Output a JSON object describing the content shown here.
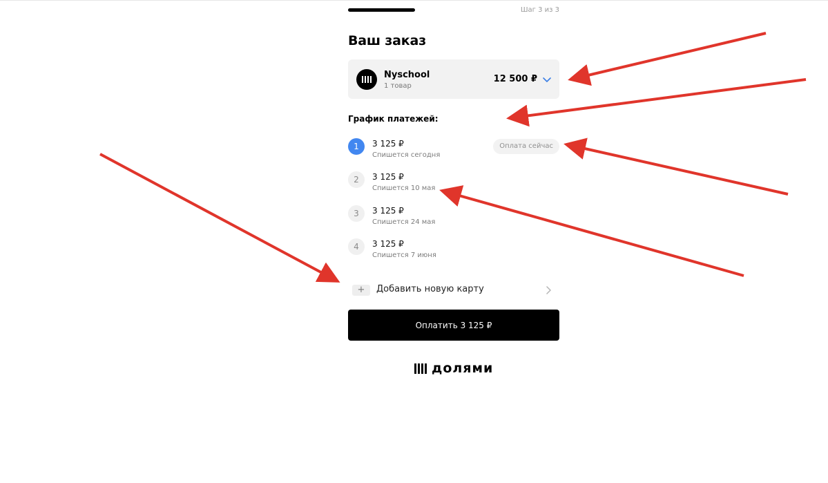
{
  "header": {
    "step_text": "Шаг 3 из 3",
    "progress_fraction": 1.0
  },
  "order": {
    "title": "Ваш заказ",
    "merchant": "Nyschool",
    "items_count": "1 товар",
    "total": "12 500 ₽"
  },
  "schedule": {
    "title": "График платежей:",
    "payments": [
      {
        "num": "1",
        "amount": "3 125 ₽",
        "date": "Спишется сегодня",
        "badge": "Оплата сейчас",
        "active": true
      },
      {
        "num": "2",
        "amount": "3 125 ₽",
        "date": "Спишется 10 мая",
        "active": false
      },
      {
        "num": "3",
        "amount": "3 125 ₽",
        "date": "Спишется 24 мая",
        "active": false
      },
      {
        "num": "4",
        "amount": "3 125 ₽",
        "date": "Спишется 7 июня",
        "active": false
      }
    ]
  },
  "card": {
    "plus_symbol": "+",
    "add_label": "Добавить новую карту"
  },
  "pay_button": {
    "label": "Оплатить 3 125 ₽"
  },
  "brand": {
    "text": "долями"
  },
  "colors": {
    "accent": "#4287f0",
    "primary_button": "#000000",
    "annotation_arrow": "#e0352b"
  },
  "icons": {
    "merchant_logo": "dolyami-bars-icon",
    "expand": "chevron-down-icon",
    "add": "plus-icon",
    "go": "chevron-right-icon"
  }
}
